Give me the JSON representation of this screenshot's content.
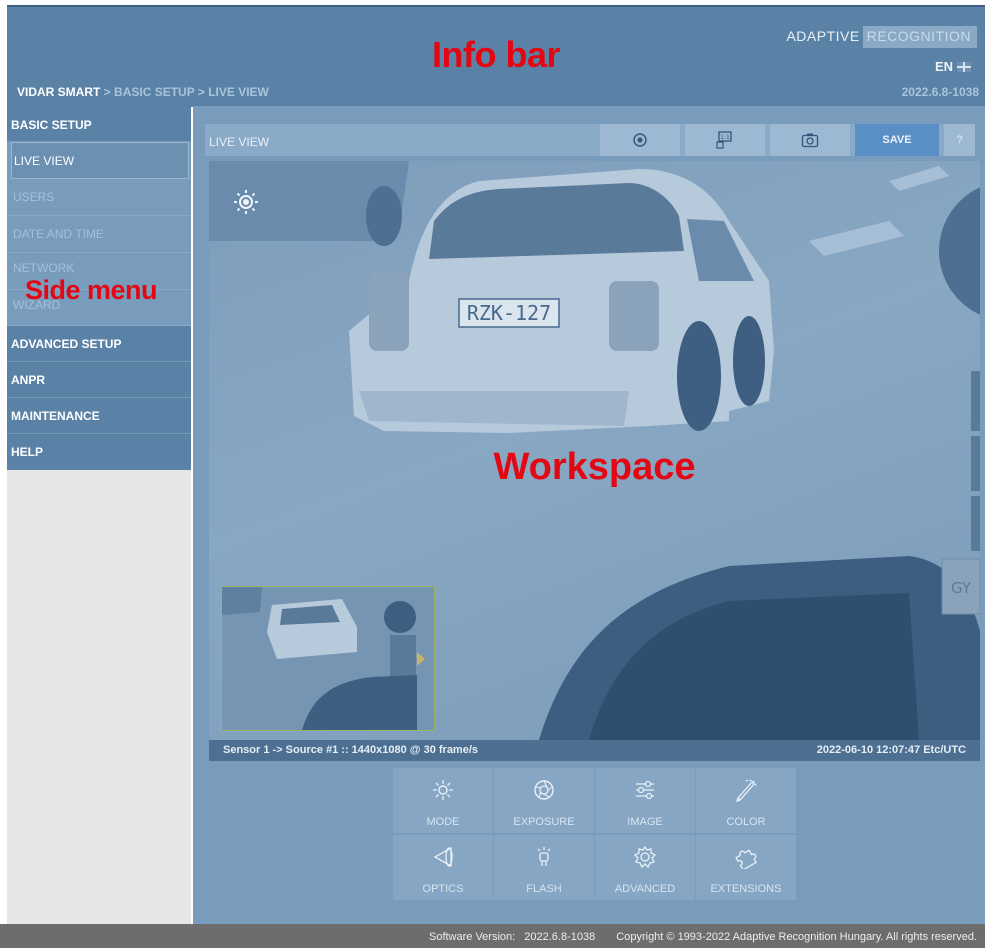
{
  "header": {
    "brand_part1": "ADAPTIVE",
    "brand_part2": "RECOGNITION",
    "language": "EN",
    "overlay_label": "Info bar",
    "breadcrumb": {
      "root": "VIDAR SMART",
      "sep1": " > ",
      "section": "BASIC SETUP",
      "sep2": " > ",
      "page": "LIVE VIEW"
    },
    "version": "2022.6.8-1038"
  },
  "sidebar": {
    "overlay_label": "Side menu",
    "sections": [
      {
        "label": "BASIC SETUP",
        "items": [
          "LIVE VIEW",
          "USERS",
          "DATE AND TIME",
          "NETWORK",
          "WIZARD"
        ],
        "active_index": 0
      },
      {
        "label": "ADVANCED SETUP"
      },
      {
        "label": "ANPR"
      },
      {
        "label": "MAINTENANCE"
      },
      {
        "label": "HELP"
      }
    ]
  },
  "workspace": {
    "overlay_label": "Workspace",
    "toolbar": {
      "title": "LIVE VIEW",
      "save_label": "SAVE",
      "help_label": "?",
      "buttons": [
        "record-icon",
        "fit-one-to-one-icon",
        "camera-snapshot-icon"
      ]
    },
    "camera": {
      "plate_text": "RZK-127",
      "side_text": "GY",
      "sensor_info": "Sensor 1 -> Source #1 :: 1440x1080 @ 30 frame/s",
      "timestamp": "2022-06-10 12:07:47 Etc/UTC"
    },
    "tools": [
      {
        "label": "MODE",
        "icon": "sun-icon"
      },
      {
        "label": "EXPOSURE",
        "icon": "aperture-icon"
      },
      {
        "label": "IMAGE",
        "icon": "sliders-icon"
      },
      {
        "label": "COLOR",
        "icon": "color-brush-icon"
      },
      {
        "label": "OPTICS",
        "icon": "lens-icon"
      },
      {
        "label": "FLASH",
        "icon": "flash-bulb-icon"
      },
      {
        "label": "ADVANCED",
        "icon": "gear-cog-icon"
      },
      {
        "label": "EXTENSIONS",
        "icon": "puzzle-icon"
      }
    ]
  },
  "footer": {
    "software_label": "Software Version:",
    "software_version": "2022.6.8-1038",
    "copyright": "Copyright © 1993-2022 Adaptive Recognition Hungary. All rights reserved."
  },
  "colors": {
    "primary": "#5a82a6",
    "overlay_red": "#e30613",
    "save": "#5a8fc6",
    "footer": "#6d6d6d"
  }
}
